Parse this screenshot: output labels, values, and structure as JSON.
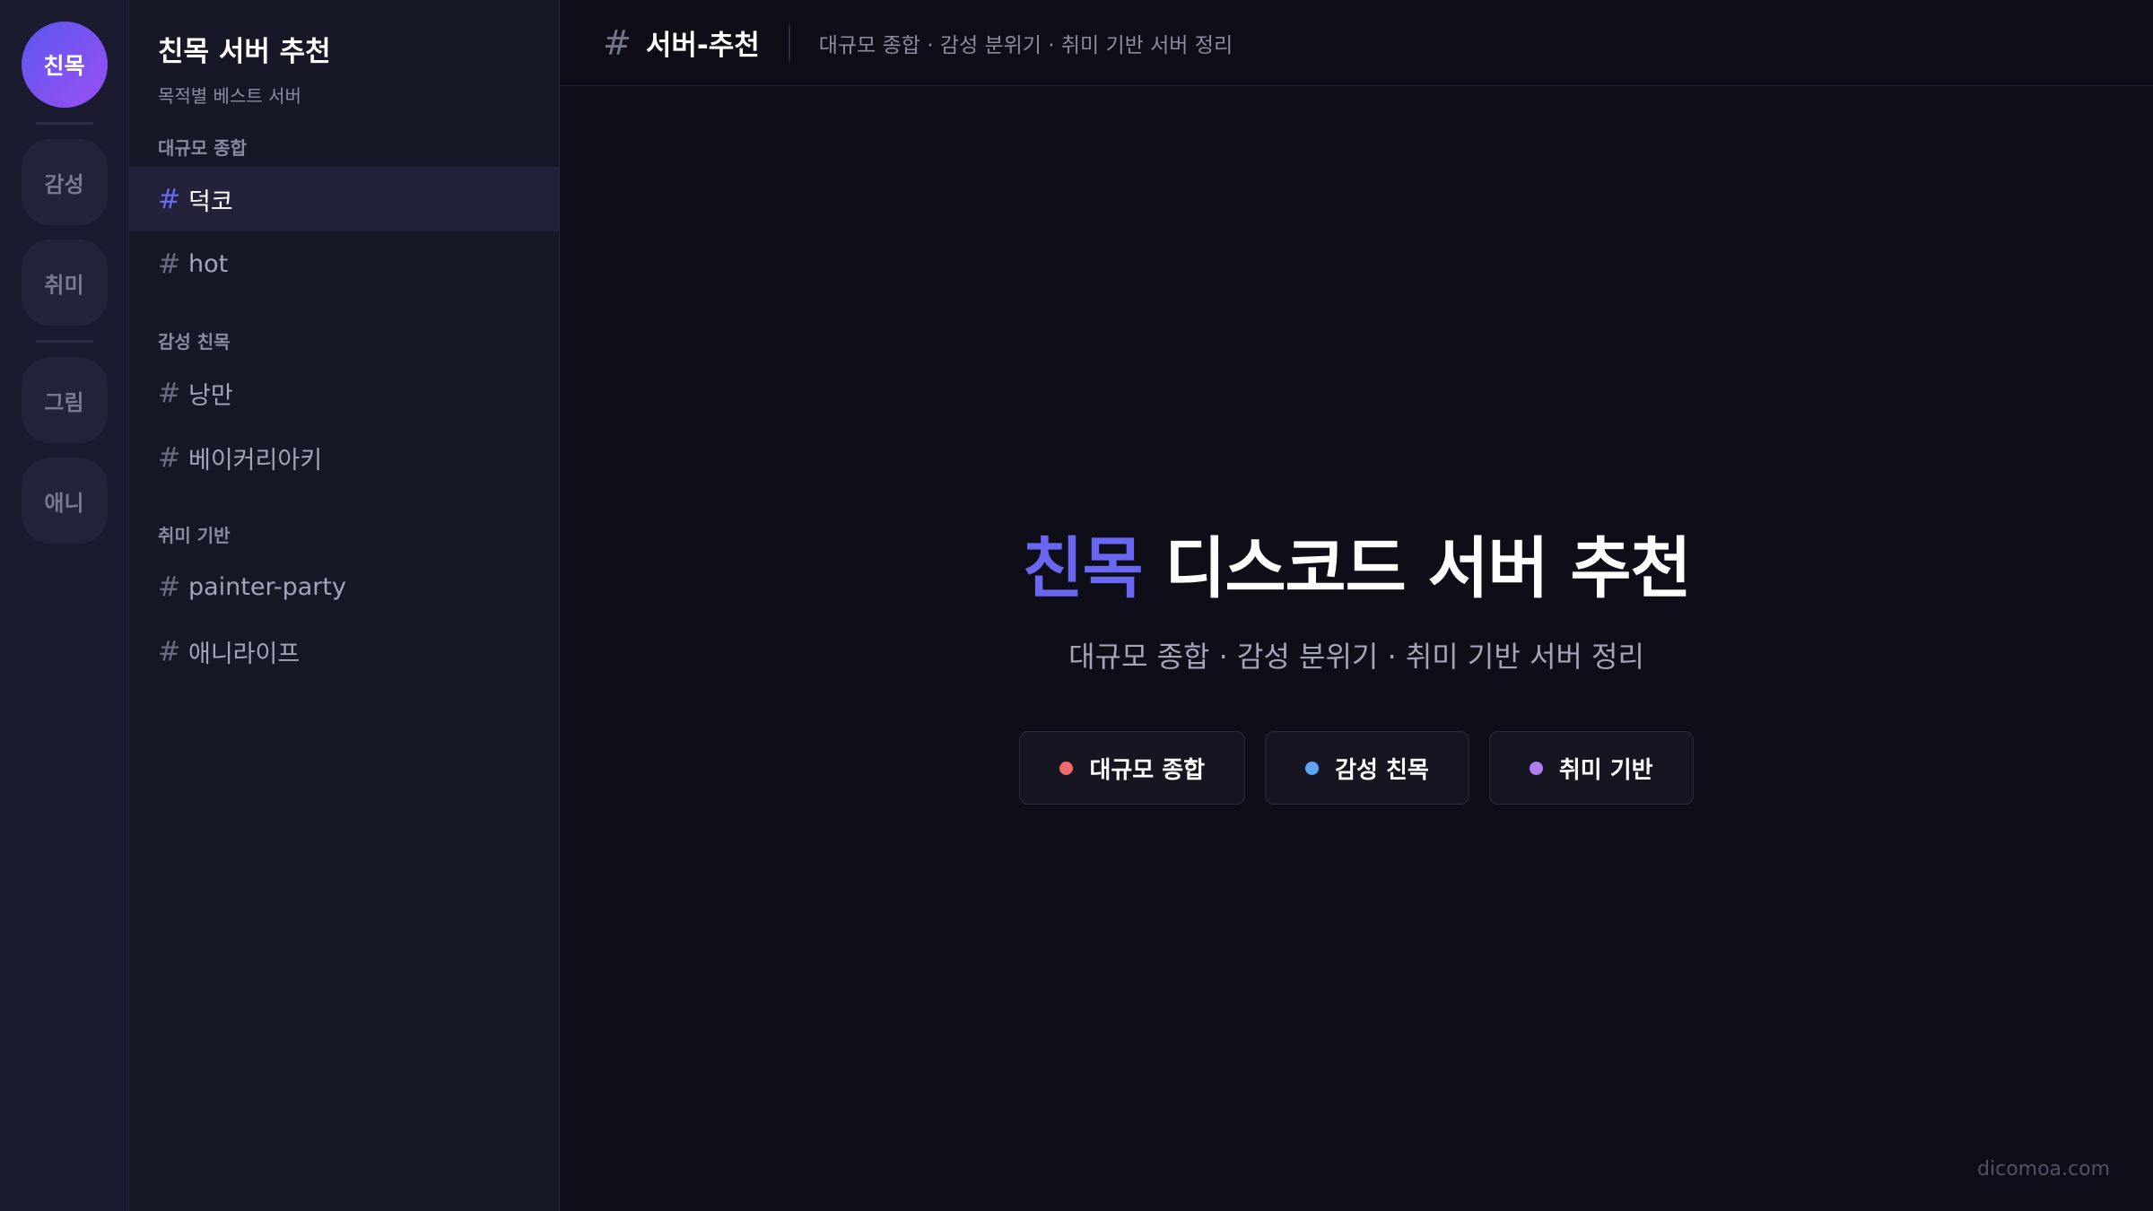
{
  "rail": {
    "servers": [
      {
        "label": "친목",
        "active": true
      },
      {
        "label": "감성",
        "active": false
      },
      {
        "label": "취미",
        "active": false
      },
      {
        "label": "그림",
        "active": false
      },
      {
        "label": "애니",
        "active": false
      }
    ]
  },
  "sidebar": {
    "title": "친목 서버 추천",
    "subtitle": "목적별 베스트 서버",
    "categories": [
      {
        "label": "대규모 종합",
        "channels": [
          {
            "name": "덕코",
            "active": true
          },
          {
            "name": "hot",
            "active": false
          }
        ]
      },
      {
        "label": "감성 친목",
        "channels": [
          {
            "name": "낭만",
            "active": false
          },
          {
            "name": "베이커리아키",
            "active": false
          }
        ]
      },
      {
        "label": "취미 기반",
        "channels": [
          {
            "name": "painter-party",
            "active": false
          },
          {
            "name": "애니라이프",
            "active": false
          }
        ]
      }
    ]
  },
  "topbar": {
    "hash": "#",
    "channel": "서버-추천",
    "topic": "대규모 종합 · 감성 분위기 · 취미 기반 서버 정리"
  },
  "hero": {
    "title_accent": "친목",
    "title_rest": " 디스코드 서버 추천",
    "subtitle": "대규모 종합 · 감성 분위기 · 취미 기반 서버 정리",
    "chips": [
      {
        "label": "대규모 종합",
        "color": "#ef6b6b"
      },
      {
        "label": "감성 친목",
        "color": "#5fa4f5"
      },
      {
        "label": "취미 기반",
        "color": "#b57cf2"
      }
    ]
  },
  "watermark": "dicomoa.com",
  "colors": {
    "accent": "#6a67f2",
    "background": "#0d0e17",
    "sidebar": "#161727",
    "rail": "#1a1b2e"
  }
}
